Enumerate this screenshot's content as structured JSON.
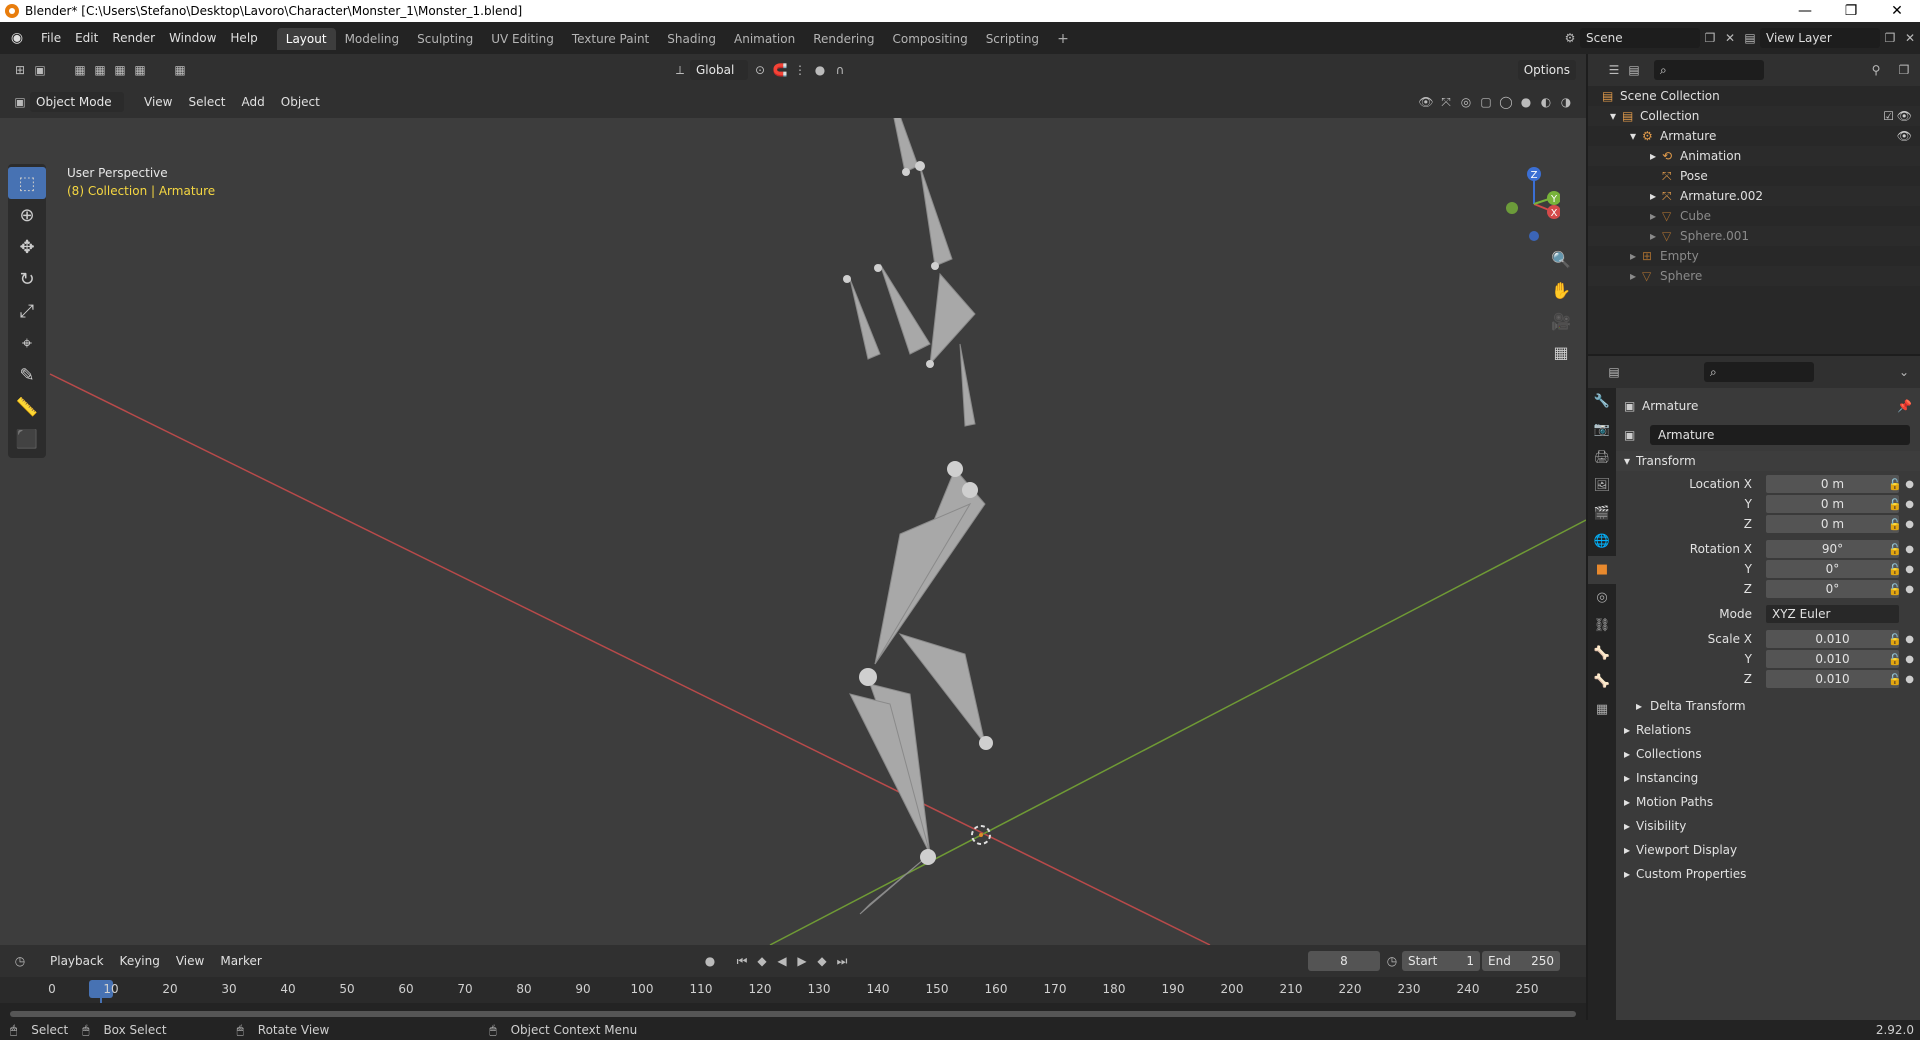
{
  "window": {
    "title": "Blender* [C:\\Users\\Stefano\\Desktop\\Lavoro\\Character\\Monster_1\\Monster_1.blend]",
    "minimize": "—",
    "restore": "❐",
    "close": "✕"
  },
  "menu": [
    "File",
    "Edit",
    "Render",
    "Window",
    "Help"
  ],
  "workspaces": [
    "Layout",
    "Modeling",
    "Sculpting",
    "UV Editing",
    "Texture Paint",
    "Shading",
    "Animation",
    "Rendering",
    "Compositing",
    "Scripting"
  ],
  "workspace_add": "+",
  "scene": {
    "name": "Scene",
    "view_layer": "View Layer"
  },
  "viewport": {
    "transform_orientation": "Global",
    "options_label": "Options",
    "mode": "Object Mode",
    "menus": [
      "View",
      "Select",
      "Add",
      "Object"
    ],
    "perspective": "User Perspective",
    "collection_info": "(8) Collection | Armature",
    "gizmo": {
      "x": "X",
      "y": "Y",
      "z": "Z"
    }
  },
  "timeline": {
    "menus": [
      "Playback",
      "Keying",
      "View",
      "Marker"
    ],
    "current_frame": "8",
    "start_label": "Start",
    "start": "1",
    "end_label": "End",
    "end": "250",
    "ticks": [
      "0",
      "10",
      "20",
      "30",
      "40",
      "50",
      "60",
      "70",
      "80",
      "90",
      "100",
      "110",
      "120",
      "130",
      "140",
      "150",
      "160",
      "170",
      "180",
      "190",
      "200",
      "210",
      "220",
      "230",
      "240",
      "250"
    ]
  },
  "statusbar": {
    "select": "Select",
    "box_select": "Box Select",
    "rotate_view": "Rotate View",
    "context_menu": "Object Context Menu",
    "version": "2.92.0"
  },
  "outliner": {
    "items": [
      {
        "label": "Scene Collection",
        "indent": 0,
        "dim": false
      },
      {
        "label": "Collection",
        "indent": 1,
        "dim": false
      },
      {
        "label": "Armature",
        "indent": 2,
        "dim": false
      },
      {
        "label": "Animation",
        "indent": 3,
        "dim": false
      },
      {
        "label": "Pose",
        "indent": 3,
        "dim": false
      },
      {
        "label": "Armature.002",
        "indent": 3,
        "dim": false
      },
      {
        "label": "Cube",
        "indent": 3,
        "dim": true
      },
      {
        "label": "Sphere.001",
        "indent": 3,
        "dim": true
      },
      {
        "label": "Empty",
        "indent": 2,
        "dim": true
      },
      {
        "label": "Sphere",
        "indent": 2,
        "dim": true
      }
    ]
  },
  "properties": {
    "object_name": "Armature",
    "data_name": "Armature",
    "transform_label": "Transform",
    "location_label": "Location X",
    "location": [
      "0 m",
      "0 m",
      "0 m"
    ],
    "rotation_label": "Rotation X",
    "rotation": [
      "90°",
      "0°",
      "0°"
    ],
    "mode_label": "Mode",
    "mode": "XYZ Euler",
    "scale_label": "Scale X",
    "scale": [
      "0.010",
      "0.010",
      "0.010"
    ],
    "y_label": "Y",
    "z_label": "Z",
    "panels": [
      "Delta Transform",
      "Relations",
      "Collections",
      "Instancing",
      "Motion Paths",
      "Visibility",
      "Viewport Display",
      "Custom Properties"
    ]
  }
}
